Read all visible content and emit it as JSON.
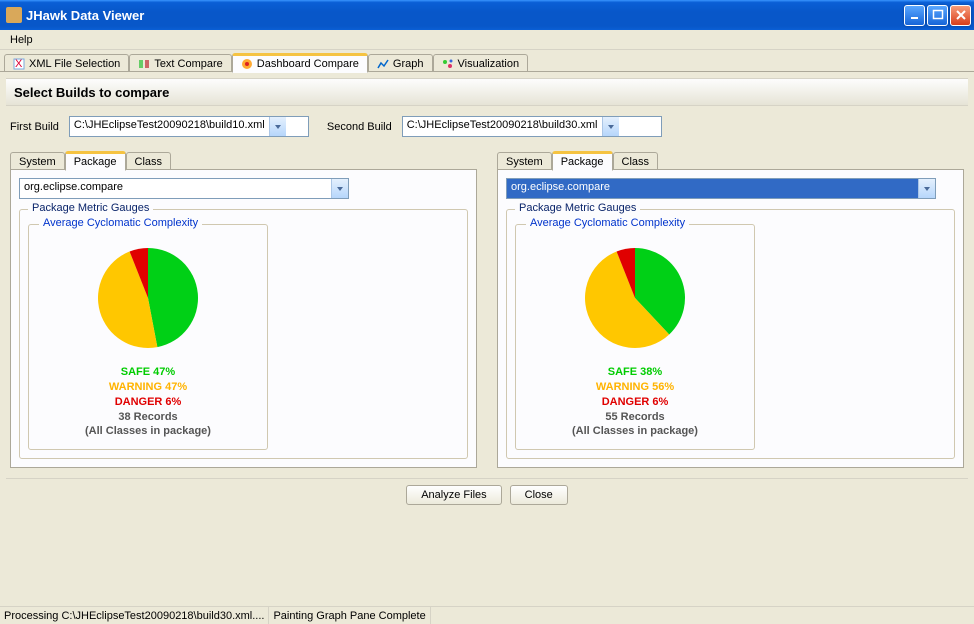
{
  "window": {
    "title": "JHawk Data Viewer"
  },
  "menu": {
    "help": "Help"
  },
  "tabs": {
    "xml": "XML File Selection",
    "textcmp": "Text Compare",
    "dashcmp": "Dashboard Compare",
    "graph": "Graph",
    "viz": "Visualization"
  },
  "header": "Select Builds to compare",
  "builds": {
    "first_label": "First Build",
    "first_value": "C:\\JHEclipseTest20090218\\build10.xml",
    "second_label": "Second Build",
    "second_value": "C:\\JHEclipseTest20090218\\build30.xml"
  },
  "inner_tabs": {
    "system": "System",
    "package": "Package",
    "class": "Class"
  },
  "package_select": "org.eclipse.compare",
  "group": {
    "outer": "Package Metric Gauges",
    "inner": "Average Cyclomatic Complexity"
  },
  "left": {
    "chart_data": {
      "type": "pie",
      "series": [
        {
          "name": "SAFE",
          "value": 47,
          "color": "#00d016"
        },
        {
          "name": "WARNING",
          "value": 47,
          "color": "#ffc700"
        },
        {
          "name": "DANGER",
          "value": 6,
          "color": "#e00000"
        }
      ]
    },
    "safe": "SAFE 47%",
    "warn": "WARNING 47%",
    "danger": "DANGER 6%",
    "records": "38 Records",
    "note": "(All Classes in package)"
  },
  "right": {
    "chart_data": {
      "type": "pie",
      "series": [
        {
          "name": "SAFE",
          "value": 38,
          "color": "#00d016"
        },
        {
          "name": "WARNING",
          "value": 56,
          "color": "#ffc700"
        },
        {
          "name": "DANGER",
          "value": 6,
          "color": "#e00000"
        }
      ]
    },
    "safe": "SAFE 38%",
    "warn": "WARNING 56%",
    "danger": "DANGER 6%",
    "records": "55 Records",
    "note": "(All Classes in package)"
  },
  "buttons": {
    "analyze": "Analyze Files",
    "close": "Close"
  },
  "status": {
    "left": "Processing C:\\JHEclipseTest20090218\\build30.xml....",
    "right": "Painting Graph Pane Complete"
  }
}
